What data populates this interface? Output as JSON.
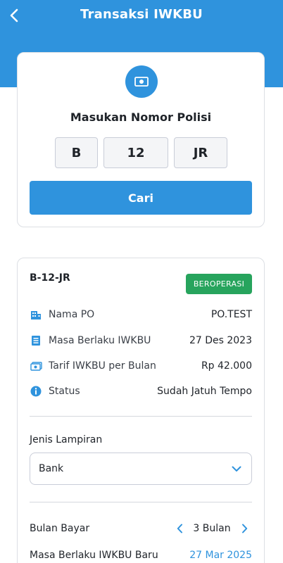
{
  "header": {
    "title": "Transaksi IWKBU"
  },
  "search": {
    "label": "Masukan Nomor Polisi",
    "plate_prefix": "B",
    "plate_number": "12",
    "plate_suffix": "JR",
    "button_label": "Cari"
  },
  "vehicle": {
    "plate": "B-12-JR",
    "status_badge": "BEROPERASI",
    "details": [
      {
        "icon": "building-icon",
        "label": "Nama PO",
        "value": "PO.TEST"
      },
      {
        "icon": "document-icon",
        "label": "Masa Berlaku IWKBU",
        "value": "27 Des 2023"
      },
      {
        "icon": "money-icon",
        "label": "Tarif IWKBU per Bulan",
        "value": "Rp 42.000"
      },
      {
        "icon": "info-icon",
        "label": "Status",
        "value": "Sudah Jatuh Tempo"
      }
    ]
  },
  "attachment": {
    "label": "Jenis Lampiran",
    "selected": "Bank"
  },
  "payment": {
    "months_label": "Bulan Bayar",
    "months_value": "3 Bulan",
    "new_validity_label": "Masa Berlaku IWKBU Baru",
    "new_validity_value": "27 Mar 2025"
  },
  "colors": {
    "primary": "#2f93dd",
    "success": "#27a45d",
    "header": "#2f93dd"
  }
}
